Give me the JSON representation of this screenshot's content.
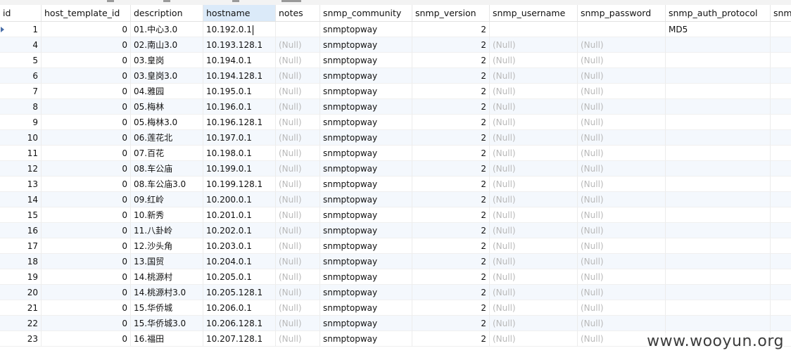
{
  "columns": [
    {
      "key": "id",
      "label": "id"
    },
    {
      "key": "host_template_id",
      "label": "host_template_id"
    },
    {
      "key": "description",
      "label": "description"
    },
    {
      "key": "hostname",
      "label": "hostname"
    },
    {
      "key": "notes",
      "label": "notes"
    },
    {
      "key": "snmp_community",
      "label": "snmp_community"
    },
    {
      "key": "snmp_version",
      "label": "snmp_version"
    },
    {
      "key": "snmp_username",
      "label": "snmp_username"
    },
    {
      "key": "snmp_password",
      "label": "snmp_password"
    },
    {
      "key": "snmp_auth_protocol",
      "label": "snmp_auth_protocol"
    },
    {
      "key": "snmp_priv",
      "label": "snmp"
    }
  ],
  "active_column": "hostname",
  "null_text": "(Null)",
  "rows": [
    {
      "id": "1",
      "host_template_id": "0",
      "description": "01.中心3.0",
      "hostname": "10.192.0.1",
      "notes": "",
      "snmp_community": "snmptopway",
      "snmp_version": "2",
      "snmp_username": "",
      "snmp_password": "",
      "snmp_auth_protocol": "MD5",
      "current": true
    },
    {
      "id": "4",
      "host_template_id": "0",
      "description": "02.南山3.0",
      "hostname": "10.193.128.1",
      "notes": null,
      "snmp_community": "snmptopway",
      "snmp_version": "2",
      "snmp_username": null,
      "snmp_password": null,
      "snmp_auth_protocol": ""
    },
    {
      "id": "5",
      "host_template_id": "0",
      "description": "03.皇岗",
      "hostname": "10.194.0.1",
      "notes": null,
      "snmp_community": "snmptopway",
      "snmp_version": "2",
      "snmp_username": null,
      "snmp_password": null,
      "snmp_auth_protocol": ""
    },
    {
      "id": "6",
      "host_template_id": "0",
      "description": "03.皇岗3.0",
      "hostname": "10.194.128.1",
      "notes": null,
      "snmp_community": "snmptopway",
      "snmp_version": "2",
      "snmp_username": null,
      "snmp_password": null,
      "snmp_auth_protocol": ""
    },
    {
      "id": "7",
      "host_template_id": "0",
      "description": "04.雅园",
      "hostname": "10.195.0.1",
      "notes": null,
      "snmp_community": "snmptopway",
      "snmp_version": "2",
      "snmp_username": null,
      "snmp_password": null,
      "snmp_auth_protocol": ""
    },
    {
      "id": "8",
      "host_template_id": "0",
      "description": "05.梅林",
      "hostname": "10.196.0.1",
      "notes": null,
      "snmp_community": "snmptopway",
      "snmp_version": "2",
      "snmp_username": null,
      "snmp_password": null,
      "snmp_auth_protocol": ""
    },
    {
      "id": "9",
      "host_template_id": "0",
      "description": "05.梅林3.0",
      "hostname": "10.196.128.1",
      "notes": null,
      "snmp_community": "snmptopway",
      "snmp_version": "2",
      "snmp_username": null,
      "snmp_password": null,
      "snmp_auth_protocol": ""
    },
    {
      "id": "10",
      "host_template_id": "0",
      "description": "06.莲花北",
      "hostname": "10.197.0.1",
      "notes": null,
      "snmp_community": "snmptopway",
      "snmp_version": "2",
      "snmp_username": null,
      "snmp_password": null,
      "snmp_auth_protocol": ""
    },
    {
      "id": "11",
      "host_template_id": "0",
      "description": "07.百花",
      "hostname": "10.198.0.1",
      "notes": null,
      "snmp_community": "snmptopway",
      "snmp_version": "2",
      "snmp_username": null,
      "snmp_password": null,
      "snmp_auth_protocol": ""
    },
    {
      "id": "12",
      "host_template_id": "0",
      "description": "08.车公庙",
      "hostname": "10.199.0.1",
      "notes": null,
      "snmp_community": "snmptopway",
      "snmp_version": "2",
      "snmp_username": null,
      "snmp_password": null,
      "snmp_auth_protocol": ""
    },
    {
      "id": "13",
      "host_template_id": "0",
      "description": "08.车公庙3.0",
      "hostname": "10.199.128.1",
      "notes": null,
      "snmp_community": "snmptopway",
      "snmp_version": "2",
      "snmp_username": null,
      "snmp_password": null,
      "snmp_auth_protocol": ""
    },
    {
      "id": "14",
      "host_template_id": "0",
      "description": "09.红岭",
      "hostname": "10.200.0.1",
      "notes": null,
      "snmp_community": "snmptopway",
      "snmp_version": "2",
      "snmp_username": null,
      "snmp_password": null,
      "snmp_auth_protocol": ""
    },
    {
      "id": "15",
      "host_template_id": "0",
      "description": "10.新秀",
      "hostname": "10.201.0.1",
      "notes": null,
      "snmp_community": "snmptopway",
      "snmp_version": "2",
      "snmp_username": null,
      "snmp_password": null,
      "snmp_auth_protocol": ""
    },
    {
      "id": "16",
      "host_template_id": "0",
      "description": "11.八卦岭",
      "hostname": "10.202.0.1",
      "notes": null,
      "snmp_community": "snmptopway",
      "snmp_version": "2",
      "snmp_username": null,
      "snmp_password": null,
      "snmp_auth_protocol": ""
    },
    {
      "id": "17",
      "host_template_id": "0",
      "description": "12.沙头角",
      "hostname": "10.203.0.1",
      "notes": null,
      "snmp_community": "snmptopway",
      "snmp_version": "2",
      "snmp_username": null,
      "snmp_password": null,
      "snmp_auth_protocol": ""
    },
    {
      "id": "18",
      "host_template_id": "0",
      "description": "13.国贸",
      "hostname": "10.204.0.1",
      "notes": null,
      "snmp_community": "snmptopway",
      "snmp_version": "2",
      "snmp_username": null,
      "snmp_password": null,
      "snmp_auth_protocol": ""
    },
    {
      "id": "19",
      "host_template_id": "0",
      "description": "14.桃源村",
      "hostname": "10.205.0.1",
      "notes": null,
      "snmp_community": "snmptopway",
      "snmp_version": "2",
      "snmp_username": null,
      "snmp_password": null,
      "snmp_auth_protocol": ""
    },
    {
      "id": "20",
      "host_template_id": "0",
      "description": "14.桃源村3.0",
      "hostname": "10.205.128.1",
      "notes": null,
      "snmp_community": "snmptopway",
      "snmp_version": "2",
      "snmp_username": null,
      "snmp_password": null,
      "snmp_auth_protocol": ""
    },
    {
      "id": "21",
      "host_template_id": "0",
      "description": "15.华侨城",
      "hostname": "10.206.0.1",
      "notes": null,
      "snmp_community": "snmptopway",
      "snmp_version": "2",
      "snmp_username": null,
      "snmp_password": null,
      "snmp_auth_protocol": ""
    },
    {
      "id": "22",
      "host_template_id": "0",
      "description": "15.华侨城3.0",
      "hostname": "10.206.128.1",
      "notes": null,
      "snmp_community": "snmptopway",
      "snmp_version": "2",
      "snmp_username": null,
      "snmp_password": null,
      "snmp_auth_protocol": ""
    },
    {
      "id": "23",
      "host_template_id": "0",
      "description": "16.福田",
      "hostname": "10.207.128.1",
      "notes": null,
      "snmp_community": "snmptopway",
      "snmp_version": "2",
      "snmp_username": null,
      "snmp_password": null,
      "snmp_auth_protocol": ""
    }
  ],
  "watermark": "www.wooyun.org",
  "colors": {
    "header_active": "#dbeaf9",
    "row_alt": "#f4f8fd",
    "null_text": "#b9b9b9",
    "row_indicator": "#4a6fa8"
  }
}
